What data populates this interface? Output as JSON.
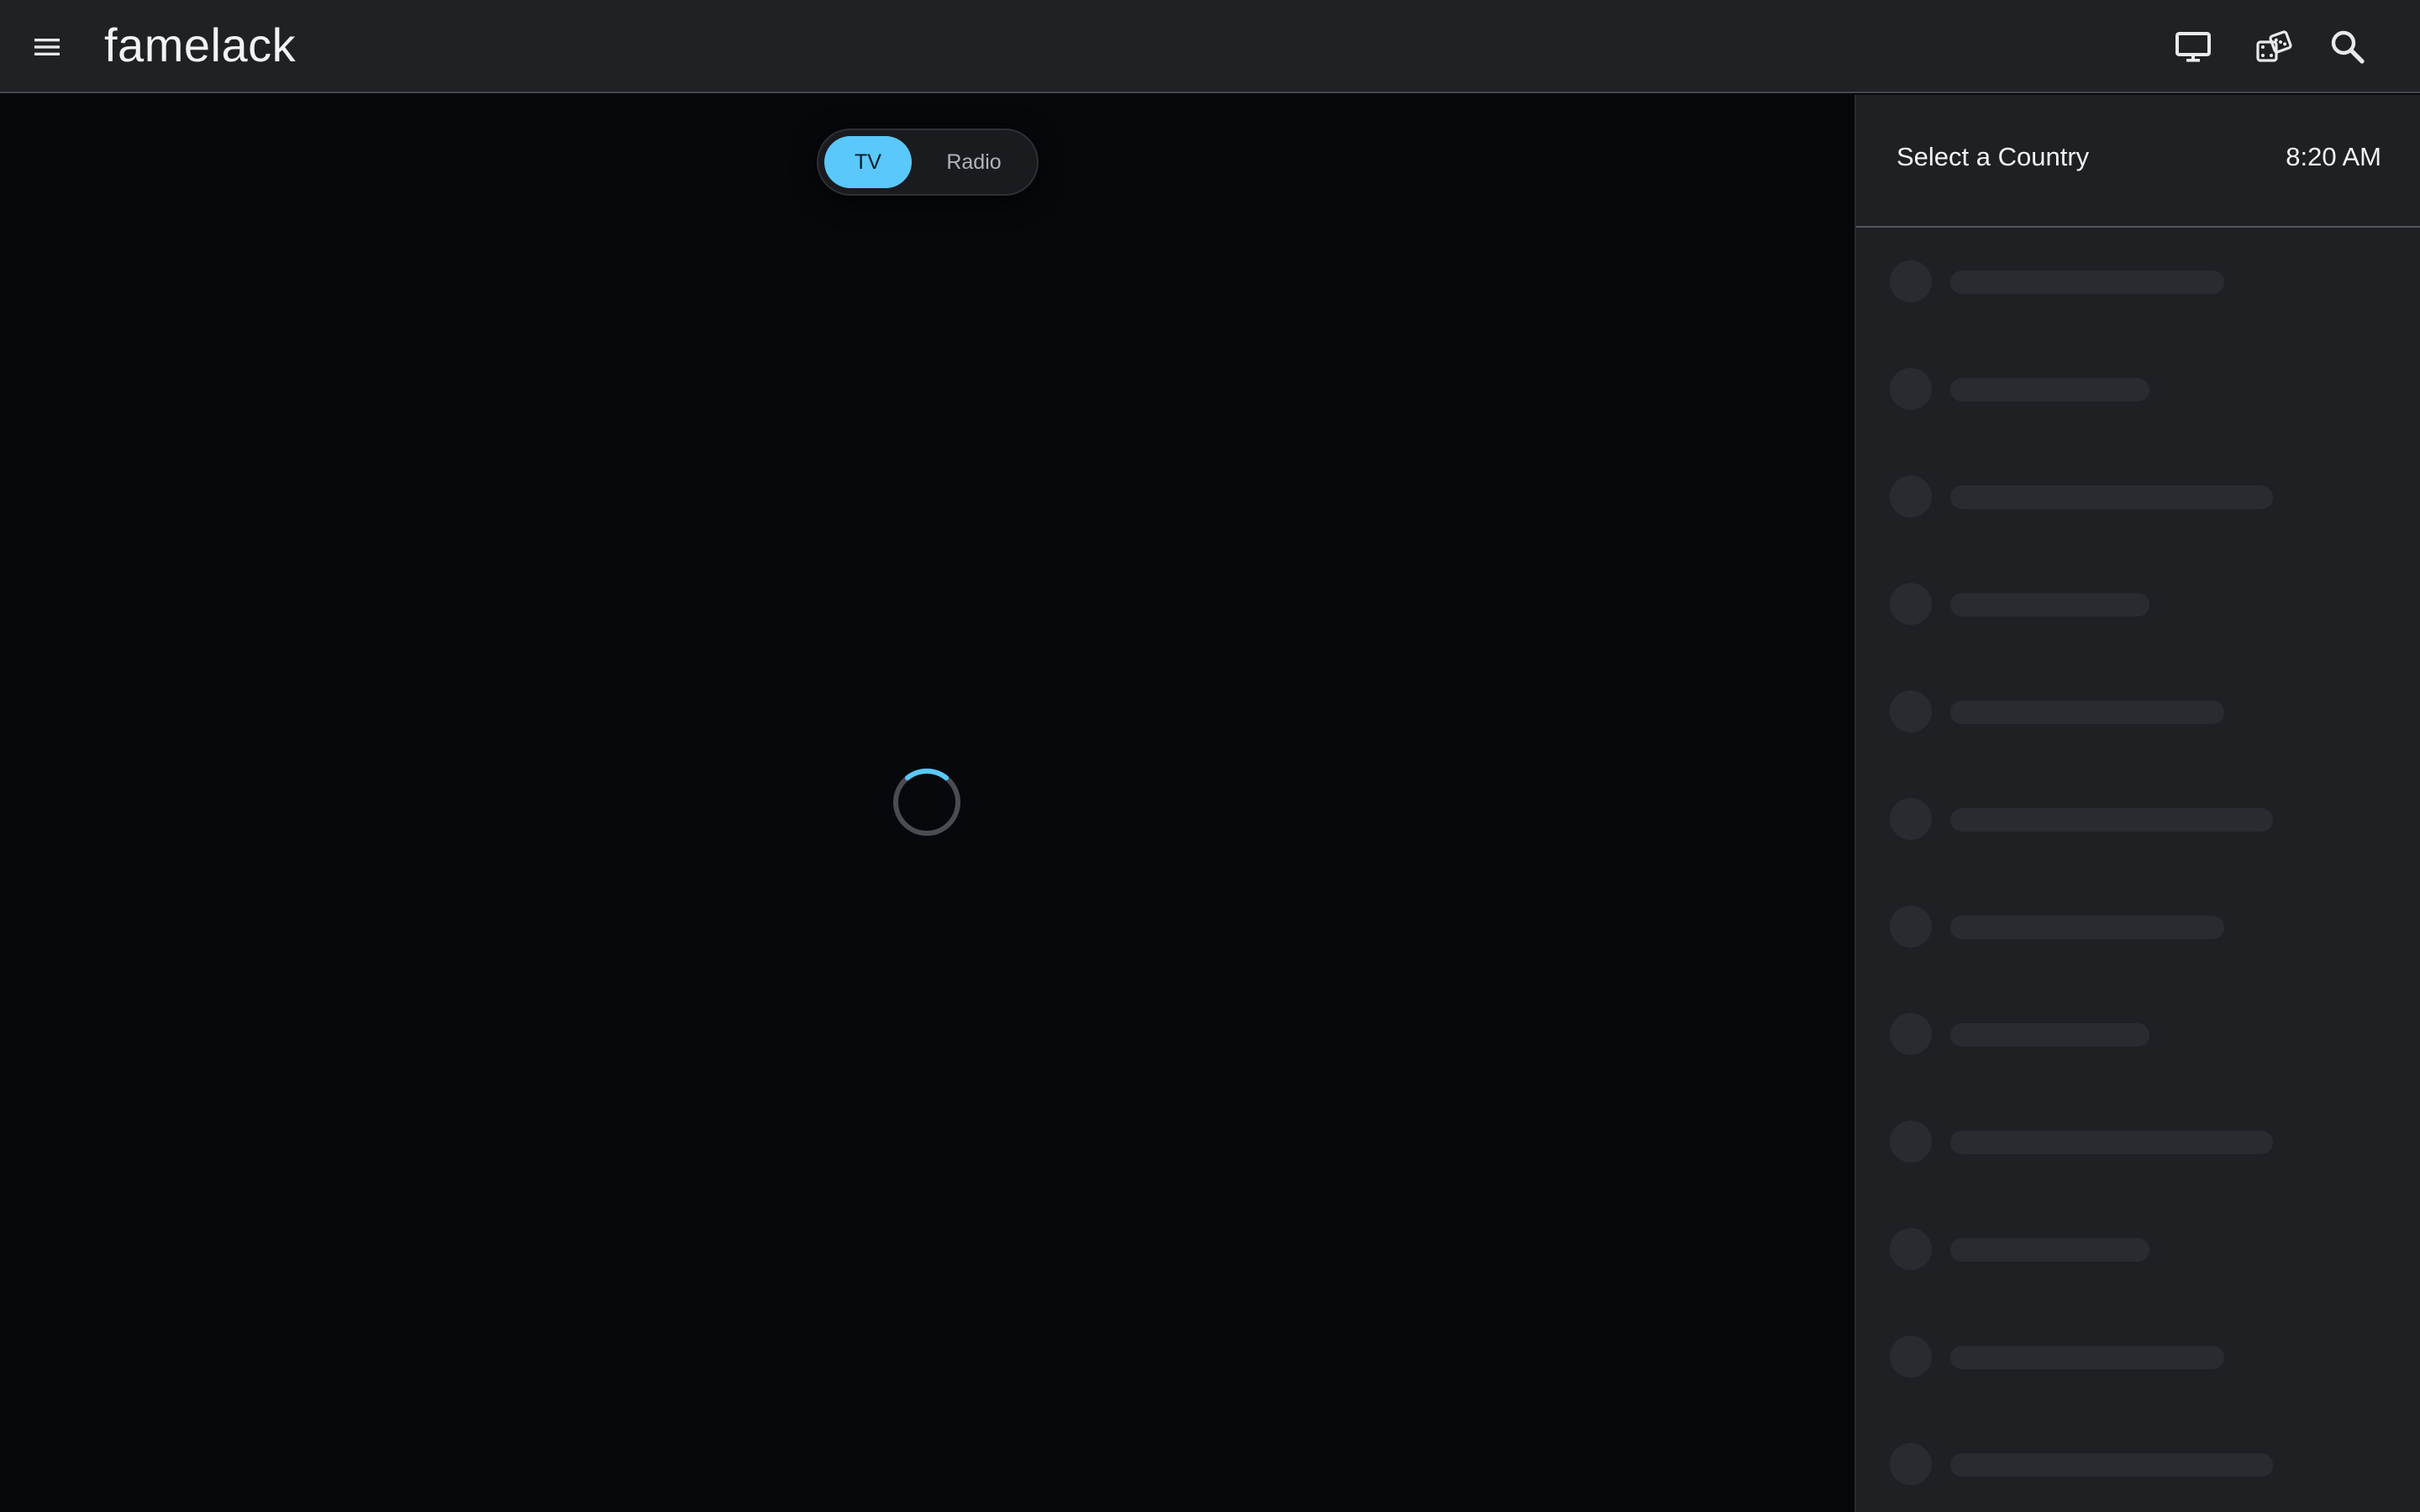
{
  "header": {
    "logo_text": "famelack",
    "icons": {
      "menu": "hamburger-menu-icon",
      "tv": "monitor-icon",
      "random": "dice-icon",
      "search": "search-icon"
    }
  },
  "main": {
    "mode_toggle": {
      "tv_label": "TV",
      "radio_label": "Radio",
      "selected": "TV"
    },
    "loading": true
  },
  "sidebar": {
    "title": "Select a Country",
    "time": "8:20 AM",
    "skeleton_rows": 12
  },
  "colors": {
    "accent": "#5ac8fa",
    "topbar_bg": "#202125",
    "main_bg": "#06080c",
    "sidebar_bg": "#1f2024",
    "skeleton": "#2a2b30"
  }
}
